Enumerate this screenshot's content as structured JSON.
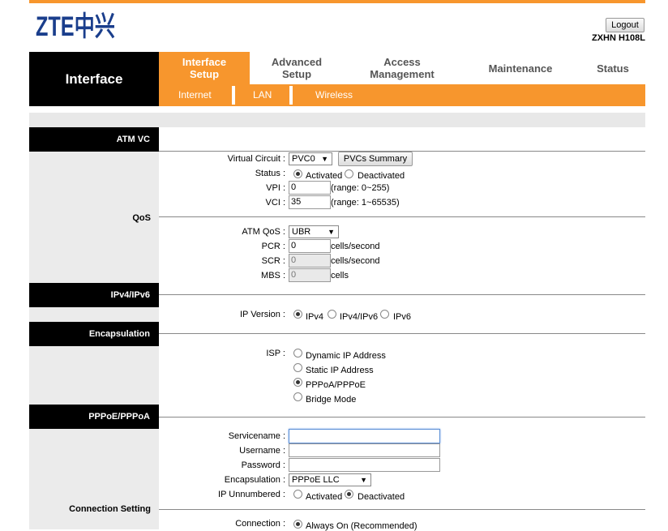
{
  "header": {
    "brand": "ZTE中兴",
    "logout_label": "Logout",
    "model": "ZXHN H108L",
    "accent_color": "#f7962d"
  },
  "nav": {
    "section_title": "Interface",
    "tabs": [
      "Interface Setup",
      "Advanced Setup",
      "Access Management",
      "Maintenance",
      "Status"
    ],
    "subtabs": [
      "Internet",
      "LAN",
      "Wireless"
    ]
  },
  "sections": {
    "atm_vc": "ATM VC",
    "qos": "QoS",
    "ip": "IPv4/IPv6",
    "encapsulation": "Encapsulation",
    "pppoe": "PPPoE/PPPoA",
    "connection_setting": "Connection Setting"
  },
  "atm": {
    "virtual_circuit_label": "Virtual Circuit :",
    "virtual_circuit_value": "PVC0",
    "pvcs_summary_label": "PVCs Summary",
    "status_label": "Status :",
    "status_options": [
      "Activated",
      "Deactivated"
    ],
    "vpi_label": "VPI :",
    "vpi_value": "0",
    "vpi_range": "(range: 0~255)",
    "vci_label": "VCI :",
    "vci_value": "35",
    "vci_range": "(range: 1~65535)"
  },
  "qos": {
    "atm_qos_label": "ATM QoS :",
    "atm_qos_value": "UBR",
    "pcr_label": "PCR :",
    "pcr_value": "0",
    "pcr_unit": "cells/second",
    "scr_label": "SCR :",
    "scr_value": "0",
    "scr_unit": "cells/second",
    "mbs_label": "MBS :",
    "mbs_value": "0",
    "mbs_unit": "cells"
  },
  "ip": {
    "version_label": "IP Version :",
    "options": [
      "IPv4",
      "IPv4/IPv6",
      "IPv6"
    ]
  },
  "encap": {
    "isp_label": "ISP :",
    "options": [
      "Dynamic IP Address",
      "Static IP Address",
      "PPPoA/PPPoE",
      "Bridge Mode"
    ]
  },
  "pppoe": {
    "servicename_label": "Servicename :",
    "servicename_value": "",
    "username_label": "Username :",
    "username_value": "",
    "password_label": "Password :",
    "password_value": "",
    "encapsulation_label": "Encapsulation :",
    "encapsulation_value": "PPPoE LLC",
    "ip_unnumbered_label": "IP Unnumbered :",
    "ip_unnumbered_options": [
      "Activated",
      "Deactivated"
    ]
  },
  "connection": {
    "label": "Connection :",
    "option": "Always On (Recommended)"
  }
}
